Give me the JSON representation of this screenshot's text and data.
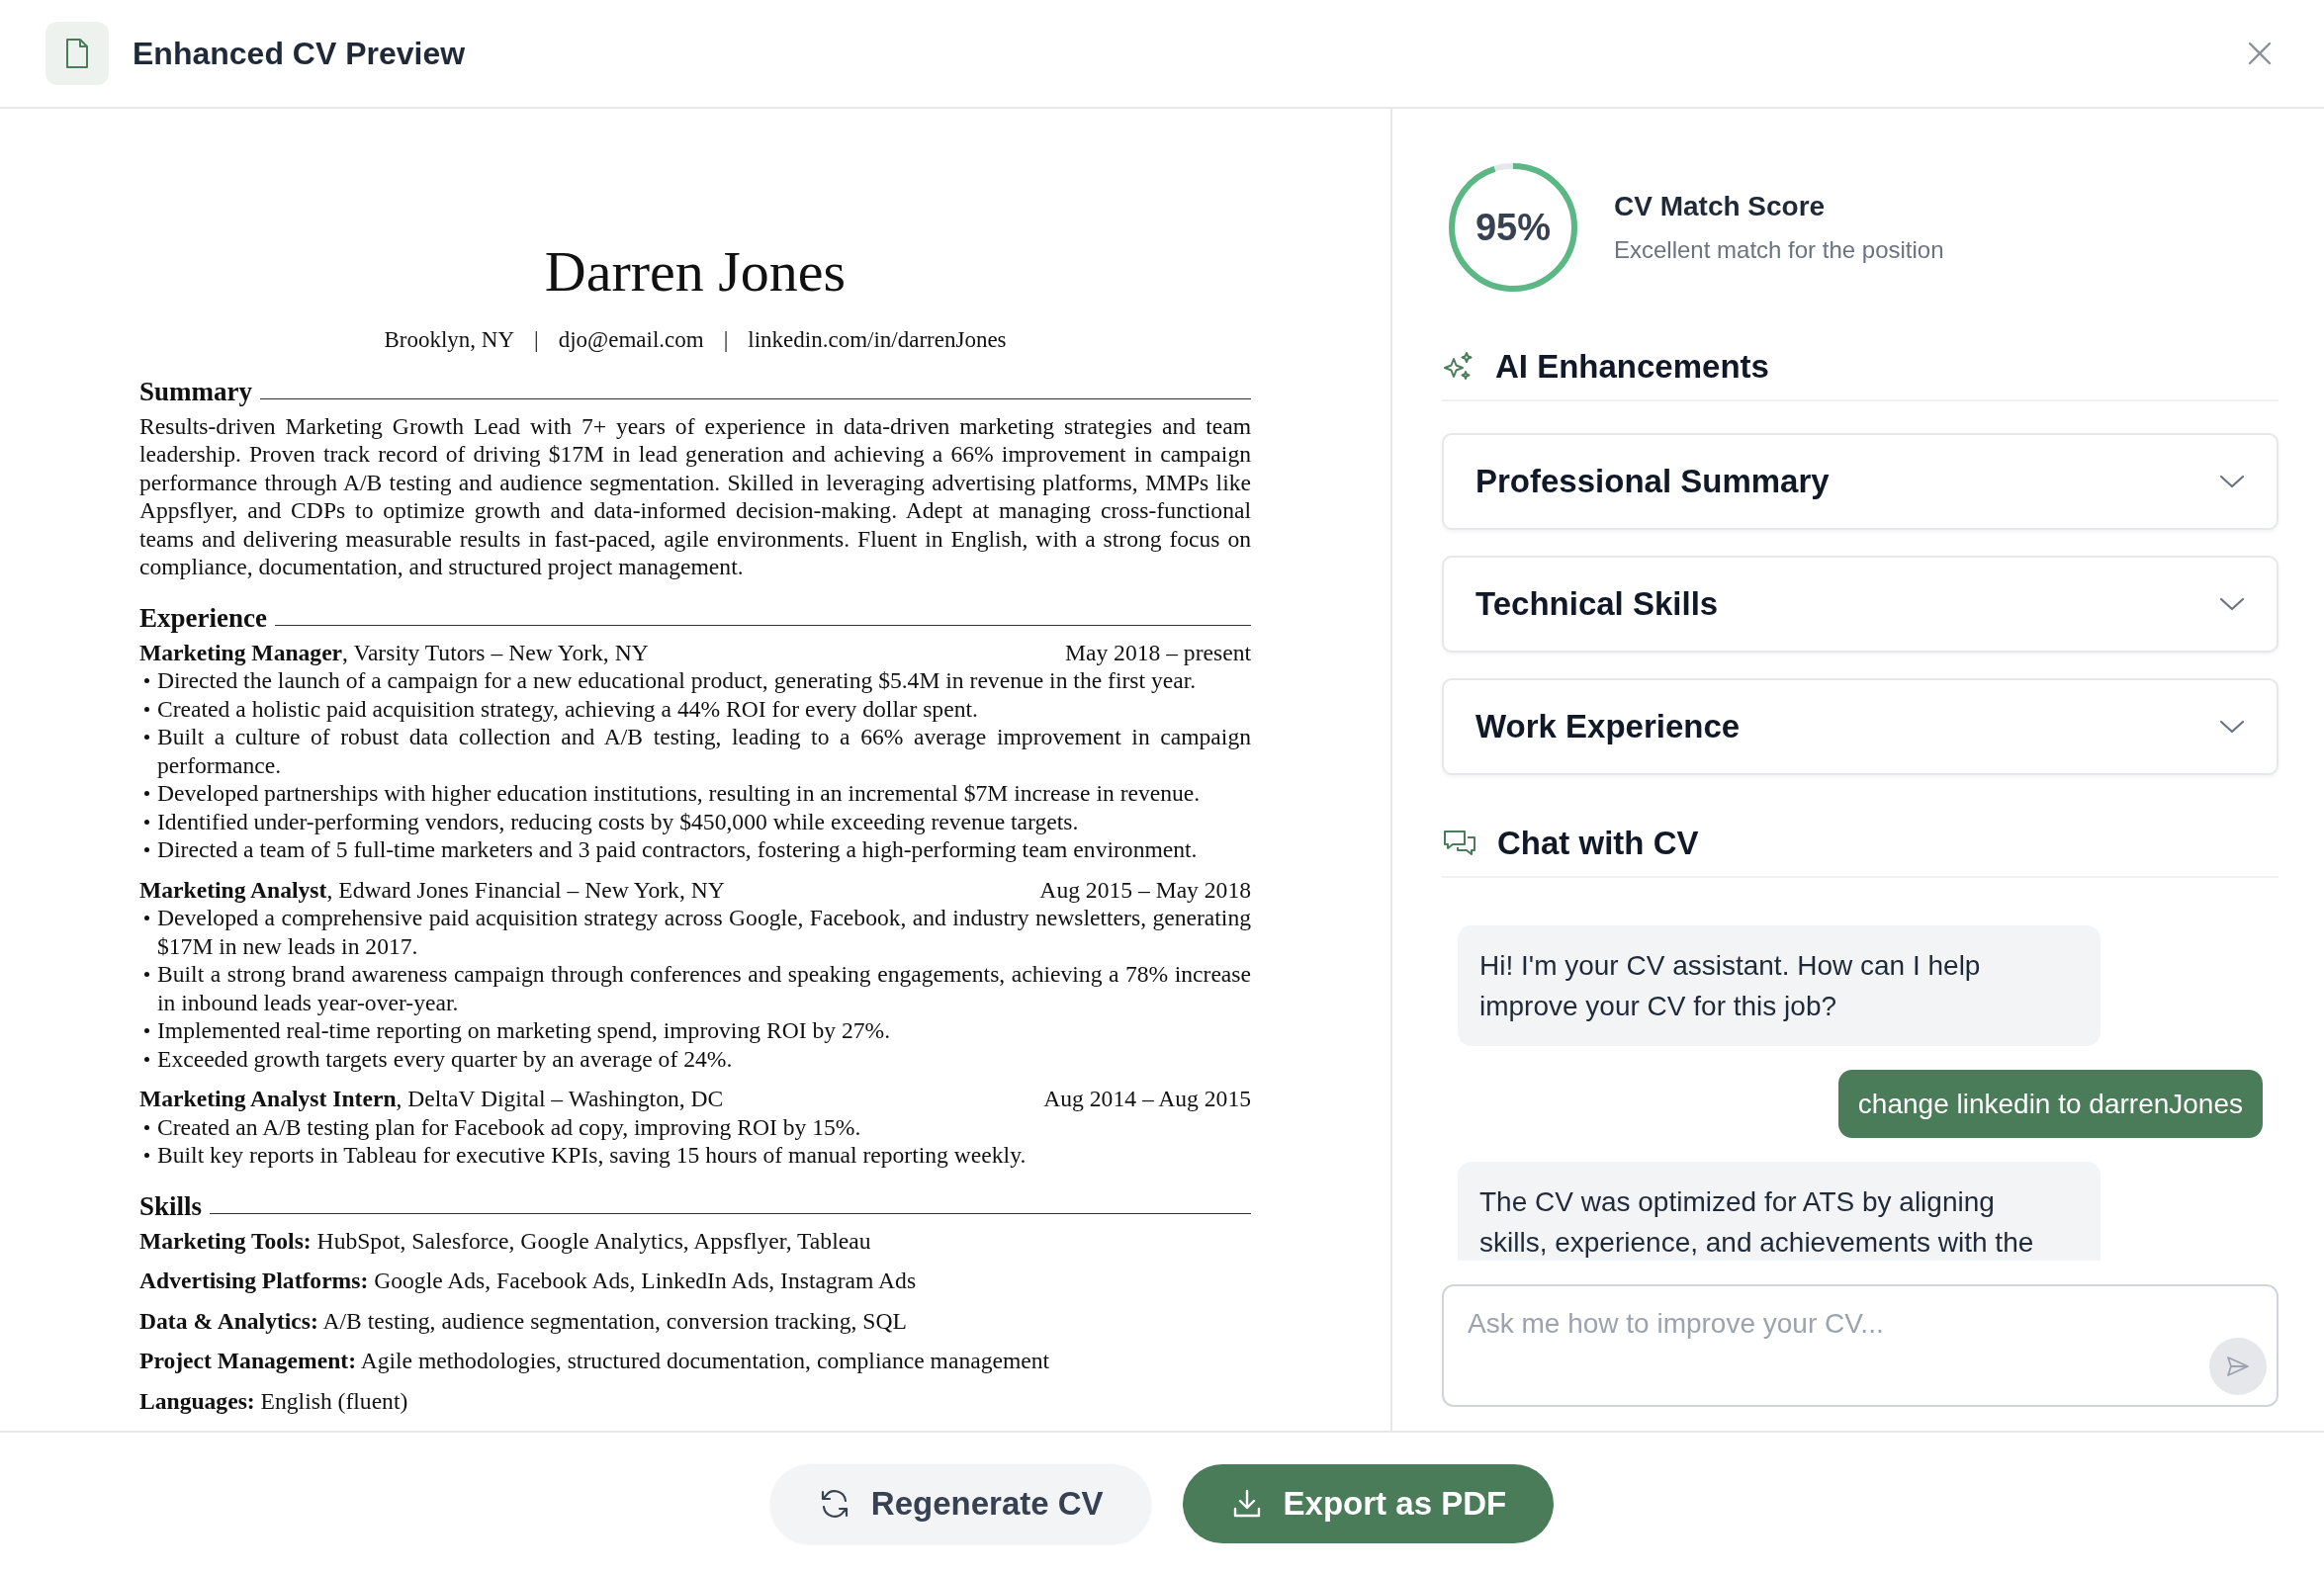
{
  "window": {
    "title": "Enhanced CV Preview"
  },
  "cv": {
    "name": "Darren Jones",
    "contacts": [
      "Brooklyn, NY",
      "djo@email.com",
      "linkedin.com/in/darrenJones"
    ],
    "separator": "|",
    "sections": [
      {
        "kind": "paragraph",
        "heading": "Summary",
        "text": "Results-driven Marketing Growth Lead with 7+ years of experience in data-driven marketing strategies and team leadership. Proven track record of driving $17M in lead generation and achieving a 66% improvement in campaign performance through A/B testing and audience segmentation. Skilled in leveraging advertising platforms, MMPs like Appsflyer, and CDPs to optimize growth and data-informed decision-making. Adept at managing cross-functional teams and delivering measurable results in fast-paced, agile environments. Fluent in English, with a strong focus on compliance, documentation, and structured project management."
      },
      {
        "kind": "jobs",
        "heading": "Experience",
        "jobs": [
          {
            "heading": "**Marketing Manager**, Varsity Tutors – New York, NY",
            "dates": "May 2018 – present",
            "bullets": [
              "Directed the launch of a campaign for a new educational product, generating $5.4M in revenue in the first year.",
              "Created a holistic paid acquisition strategy, achieving a 44% ROI for every dollar spent.",
              "Built a culture of robust data collection and A/B testing, leading to a 66% average improvement in campaign performance.",
              "Developed partnerships with higher education institutions, resulting in an incremental $7M increase in revenue.",
              "Identified under-performing vendors, reducing costs by $450,000 while exceeding revenue targets.",
              "Directed a team of 5 full-time marketers and 3 paid contractors, fostering a high-performing team environment."
            ]
          },
          {
            "heading": "**Marketing Analyst**, Edward Jones Financial – New York, NY",
            "dates": "Aug 2015 – May 2018",
            "bullets": [
              "Developed a comprehensive paid acquisition strategy across Google, Facebook, and industry newsletters, generating $17M in new leads in 2017.",
              "Built a strong brand awareness campaign through conferences and speaking engagements, achieving a 78% increase in inbound leads year-over-year.",
              "Implemented real-time reporting on marketing spend, improving ROI by 27%.",
              "Exceeded growth targets every quarter by an average of 24%."
            ]
          },
          {
            "heading": "**Marketing Analyst Intern**, DeltaV Digital – Washington, DC",
            "dates": "Aug 2014 – Aug 2015",
            "bullets": [
              "Created an A/B testing plan for Facebook ad copy, improving ROI by 15%.",
              "Built key reports in Tableau for executive KPIs, saving 15 hours of manual reporting weekly."
            ]
          }
        ]
      },
      {
        "kind": "skills",
        "heading": "Skills",
        "skills": [
          {
            "label": "Marketing Tools:",
            "value": "HubSpot, Salesforce, Google Analytics, Appsflyer, Tableau"
          },
          {
            "label": "Advertising Platforms:",
            "value": "Google Ads, Facebook Ads, LinkedIn Ads, Instagram Ads"
          },
          {
            "label": "Data & Analytics:",
            "value": "A/B testing, audience segmentation, conversion tracking, SQL"
          },
          {
            "label": "Project Management:",
            "value": "Agile methodologies, structured documentation, compliance management"
          },
          {
            "label": "Languages:",
            "value": "English (fluent)"
          }
        ]
      }
    ]
  },
  "score": {
    "value": "95%",
    "level": 0.95,
    "title": "CV Match Score",
    "subtitle": "Excellent match for the position"
  },
  "enhancements": {
    "title": "AI Enhancements",
    "items": [
      {
        "label": "Professional Summary",
        "expanded": false
      },
      {
        "label": "Technical Skills",
        "expanded": false
      },
      {
        "label": "Work Experience",
        "expanded": false
      }
    ]
  },
  "chat": {
    "title": "Chat with CV",
    "messages": [
      {
        "kind": "assistant",
        "text": "Hi! I'm your CV assistant. How can I help improve your CV for this job?"
      },
      {
        "kind": "user",
        "text": "change linkedin to darrenJones"
      },
      {
        "kind": "assistant",
        "text": "The CV was optimized for ATS by aligning skills, experience, and achievements with the"
      }
    ],
    "placeholder": "Ask me how to improve your CV..."
  },
  "buttons": [
    {
      "kind": "secondary",
      "label": "Regenerate CV"
    },
    {
      "kind": "primary",
      "label": "Export as PDF"
    }
  ]
}
